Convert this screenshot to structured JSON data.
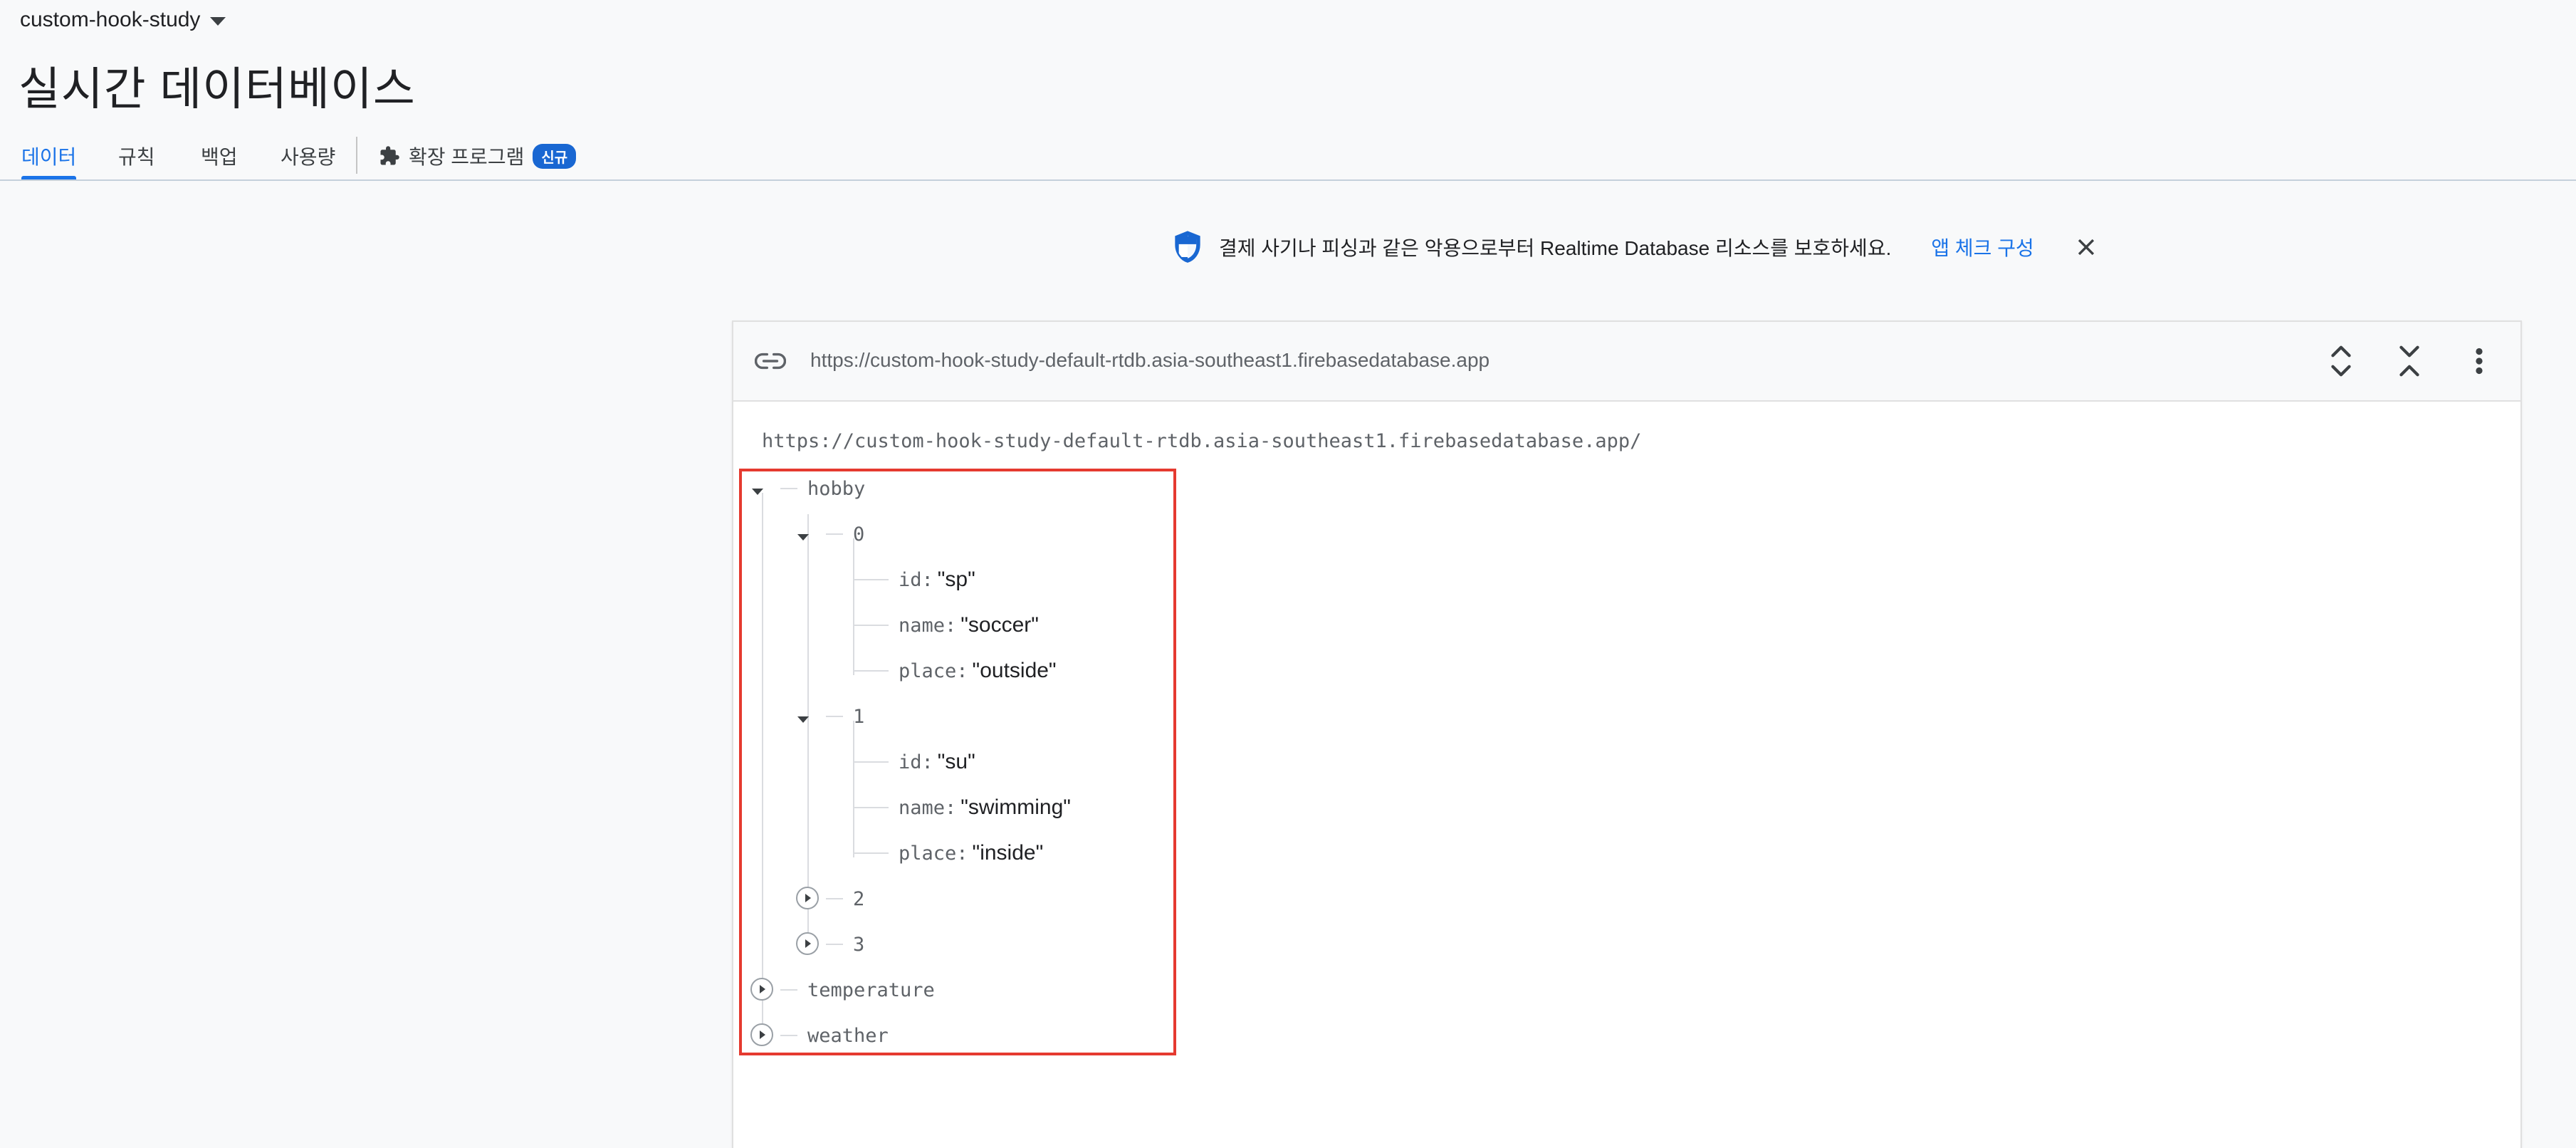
{
  "project": {
    "name": "custom-hook-study"
  },
  "page": {
    "title": "실시간 데이터베이스"
  },
  "tabs": [
    {
      "label": "데이터",
      "active": true
    },
    {
      "label": "규칙",
      "active": false
    },
    {
      "label": "백업",
      "active": false
    },
    {
      "label": "사용량",
      "active": false
    },
    {
      "label": "확장 프로그램",
      "badge": "신규",
      "active": false
    }
  ],
  "banner": {
    "text": "결제 사기나 피싱과 같은 악용으로부터 Realtime Database 리소스를 보호하세요.",
    "link": "앱 체크 구성"
  },
  "database": {
    "url": "https://custom-hook-study-default-rtdb.asia-southeast1.firebasedatabase.app",
    "root_url": "https://custom-hook-study-default-rtdb.asia-southeast1.firebasedatabase.app/"
  },
  "tree": {
    "hobby": "hobby",
    "item0": "0",
    "item0_id_key": "id:",
    "item0_id_val": "\"sp\"",
    "item0_name_key": "name:",
    "item0_name_val": "\"soccer\"",
    "item0_place_key": "place:",
    "item0_place_val": "\"outside\"",
    "item1": "1",
    "item1_id_key": "id:",
    "item1_id_val": "\"su\"",
    "item1_name_key": "name:",
    "item1_name_val": "\"swimming\"",
    "item1_place_key": "place:",
    "item1_place_val": "\"inside\"",
    "item2": "2",
    "item3": "3",
    "temperature": "temperature",
    "weather": "weather"
  },
  "colors": {
    "accent": "#1a73e8",
    "highlight": "#e53a30",
    "badge": "#1967d2",
    "shield": "#1967d2"
  }
}
